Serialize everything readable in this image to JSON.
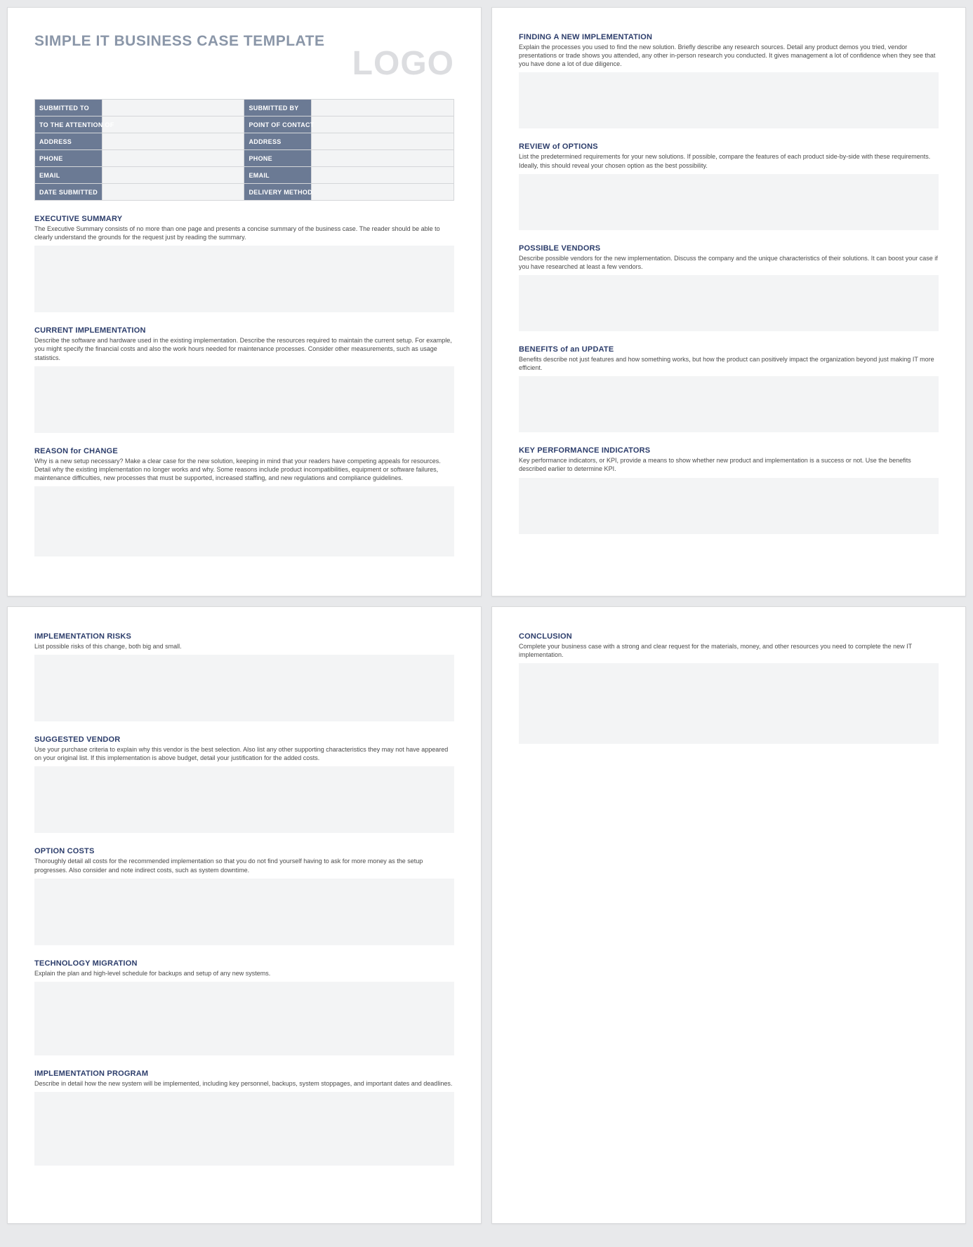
{
  "title": "SIMPLE IT BUSINESS CASE TEMPLATE",
  "logo": "LOGO",
  "meta": {
    "rows": [
      {
        "l1": "SUBMITTED TO",
        "l2": "SUBMITTED BY"
      },
      {
        "l1": "TO THE ATTENTION OF",
        "l2": "POINT OF CONTACT"
      },
      {
        "l1": "ADDRESS",
        "l2": "ADDRESS"
      },
      {
        "l1": "PHONE",
        "l2": "PHONE"
      },
      {
        "l1": "EMAIL",
        "l2": "EMAIL"
      },
      {
        "l1": "DATE SUBMITTED",
        "l2": "DELIVERY METHOD"
      }
    ]
  },
  "sections": {
    "exec_summary": {
      "title": "EXECUTIVE SUMMARY",
      "desc": "The Executive Summary consists of no more than one page and presents a concise summary of the business case. The reader should be able to clearly understand the grounds for the request just by reading the summary."
    },
    "current_impl": {
      "title": "CURRENT IMPLEMENTATION",
      "desc": "Describe the software and hardware used in the existing implementation. Describe the resources required to maintain the current setup. For example, you might specify the financial costs and also the work hours needed for maintenance processes. Consider other measurements, such as usage statistics."
    },
    "reason_change": {
      "title": "REASON for CHANGE",
      "desc": "Why is a new setup necessary? Make a clear case for the new solution, keeping in mind that your readers have competing appeals for resources. Detail why the existing implementation no longer works and why. Some reasons include product incompatibilities, equipment or software failures, maintenance difficulties, new processes that must be supported, increased staffing, and new regulations and compliance guidelines."
    },
    "finding_impl": {
      "title": "FINDING A NEW IMPLEMENTATION",
      "desc": "Explain the processes you used to find the new solution. Briefly describe any research sources. Detail any product demos you tried, vendor presentations or trade shows you attended, any other in-person research you conducted. It gives management a lot of confidence when they see that you have done a lot of due diligence."
    },
    "review_options": {
      "title": "REVIEW of OPTIONS",
      "desc": "List the predetermined requirements for your new solutions. If possible, compare the features of each product side-by-side with these requirements. Ideally, this should reveal your chosen option as the best possibility."
    },
    "possible_vendors": {
      "title": "POSSIBLE VENDORS",
      "desc": "Describe possible vendors for the new implementation. Discuss the company and the unique characteristics of their solutions. It can boost your case if you have researched at least a few vendors."
    },
    "benefits_update": {
      "title": "BENEFITS of an UPDATE",
      "desc": "Benefits describe not just features and how something works, but how the product can positively impact the organization beyond just making IT more efficient."
    },
    "kpi": {
      "title": "KEY PERFORMANCE INDICATORS",
      "desc": "Key performance indicators, or KPI, provide a means to show whether new product and implementation is a success or not. Use the benefits described earlier to determine KPI."
    },
    "impl_risks": {
      "title": "IMPLEMENTATION RISKS",
      "desc": "List possible risks of this change, both big and small."
    },
    "suggested_vendor": {
      "title": "SUGGESTED VENDOR",
      "desc": "Use your purchase criteria to explain why this vendor is the best selection. Also list any other supporting characteristics they may not have appeared on your original list. If this implementation is above budget, detail your justification for the added costs."
    },
    "option_costs": {
      "title": "OPTION COSTS",
      "desc": "Thoroughly detail all costs for the recommended implementation so that you do not find yourself having to ask for more money as the setup progresses. Also consider and note indirect costs, such as system downtime."
    },
    "tech_migration": {
      "title": "TECHNOLOGY MIGRATION",
      "desc": "Explain the plan and high-level schedule for backups and setup of any new systems."
    },
    "impl_program": {
      "title": "IMPLEMENTATION PROGRAM",
      "desc": "Describe in detail how the new system will be implemented, including key personnel, backups, system stoppages, and important dates and deadlines."
    },
    "conclusion": {
      "title": "CONCLUSION",
      "desc": "Complete your business case with a strong and clear request for the materials, money, and other resources you need to complete the new IT implementation."
    }
  }
}
